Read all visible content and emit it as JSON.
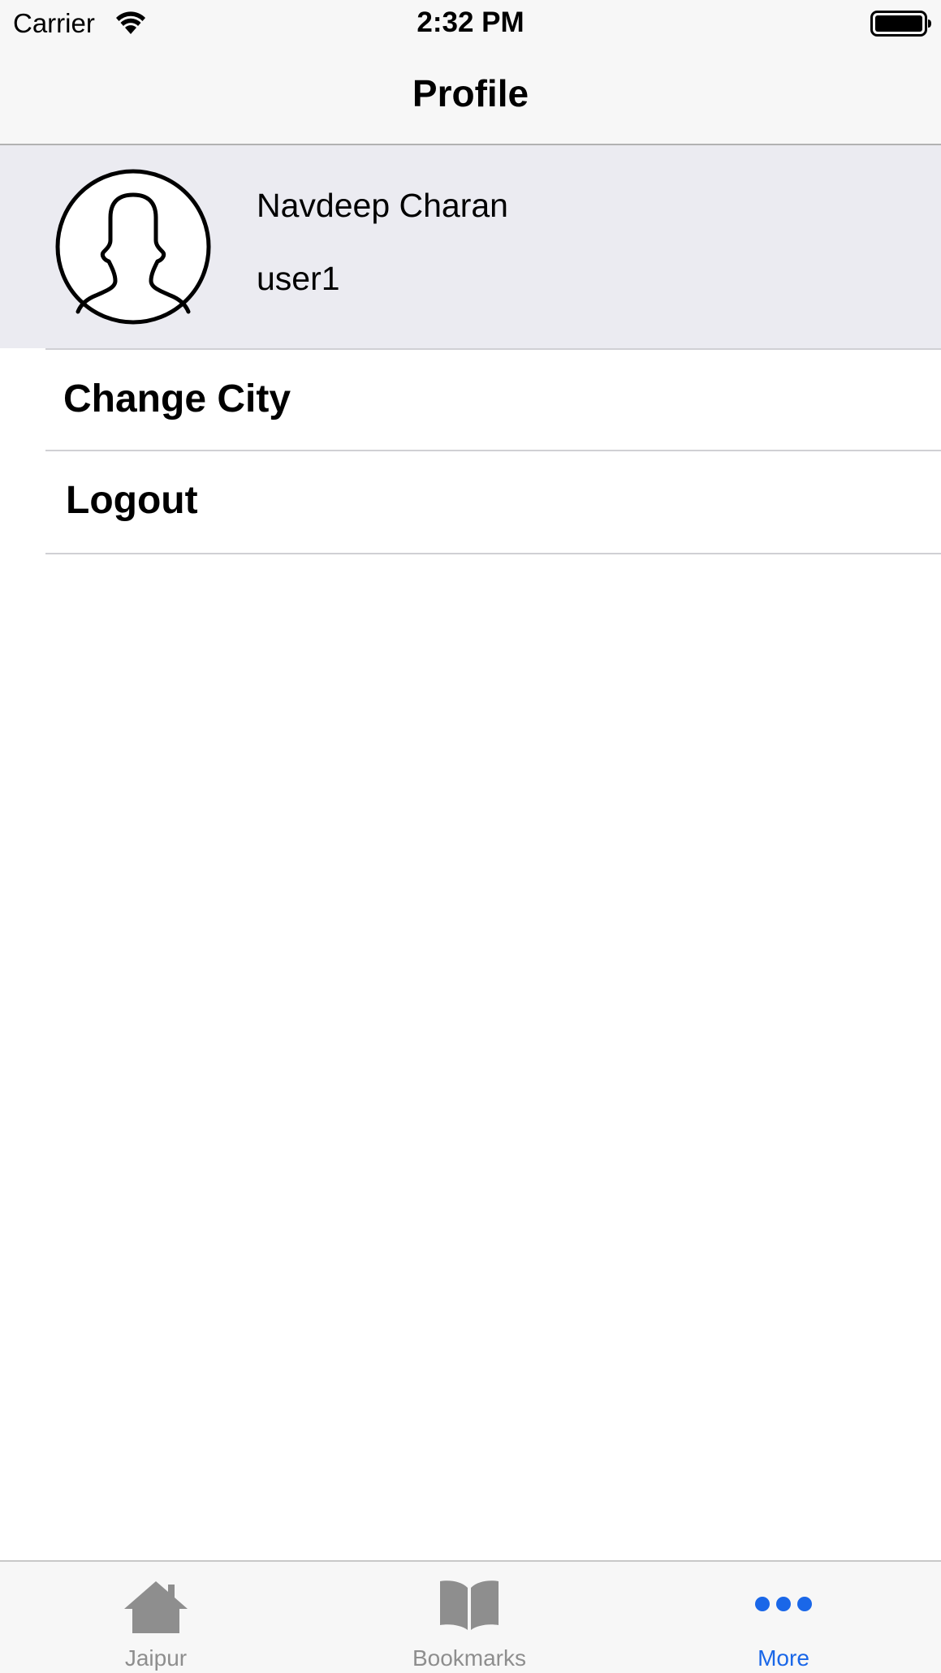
{
  "status_bar": {
    "carrier": "Carrier",
    "time": "2:32 PM",
    "wifi_icon": "wifi-icon",
    "battery_icon": "battery-icon"
  },
  "nav_bar": {
    "title": "Profile"
  },
  "profile": {
    "avatar_icon": "user-silhouette-icon",
    "name": "Navdeep Charan",
    "username": "user1"
  },
  "menu": {
    "items": [
      {
        "label": "Change City"
      },
      {
        "label": "Logout"
      }
    ]
  },
  "tab_bar": {
    "tabs": [
      {
        "label": "Jaipur",
        "icon": "house-icon",
        "active": false
      },
      {
        "label": "Bookmarks",
        "icon": "open-book-icon",
        "active": false
      },
      {
        "label": "More",
        "icon": "more-dots-icon",
        "active": true
      }
    ]
  },
  "colors": {
    "accent": "#1a67e8",
    "inactive": "#8e8e8e",
    "header_background": "#ebebf1",
    "bar_background": "#f7f7f7"
  }
}
